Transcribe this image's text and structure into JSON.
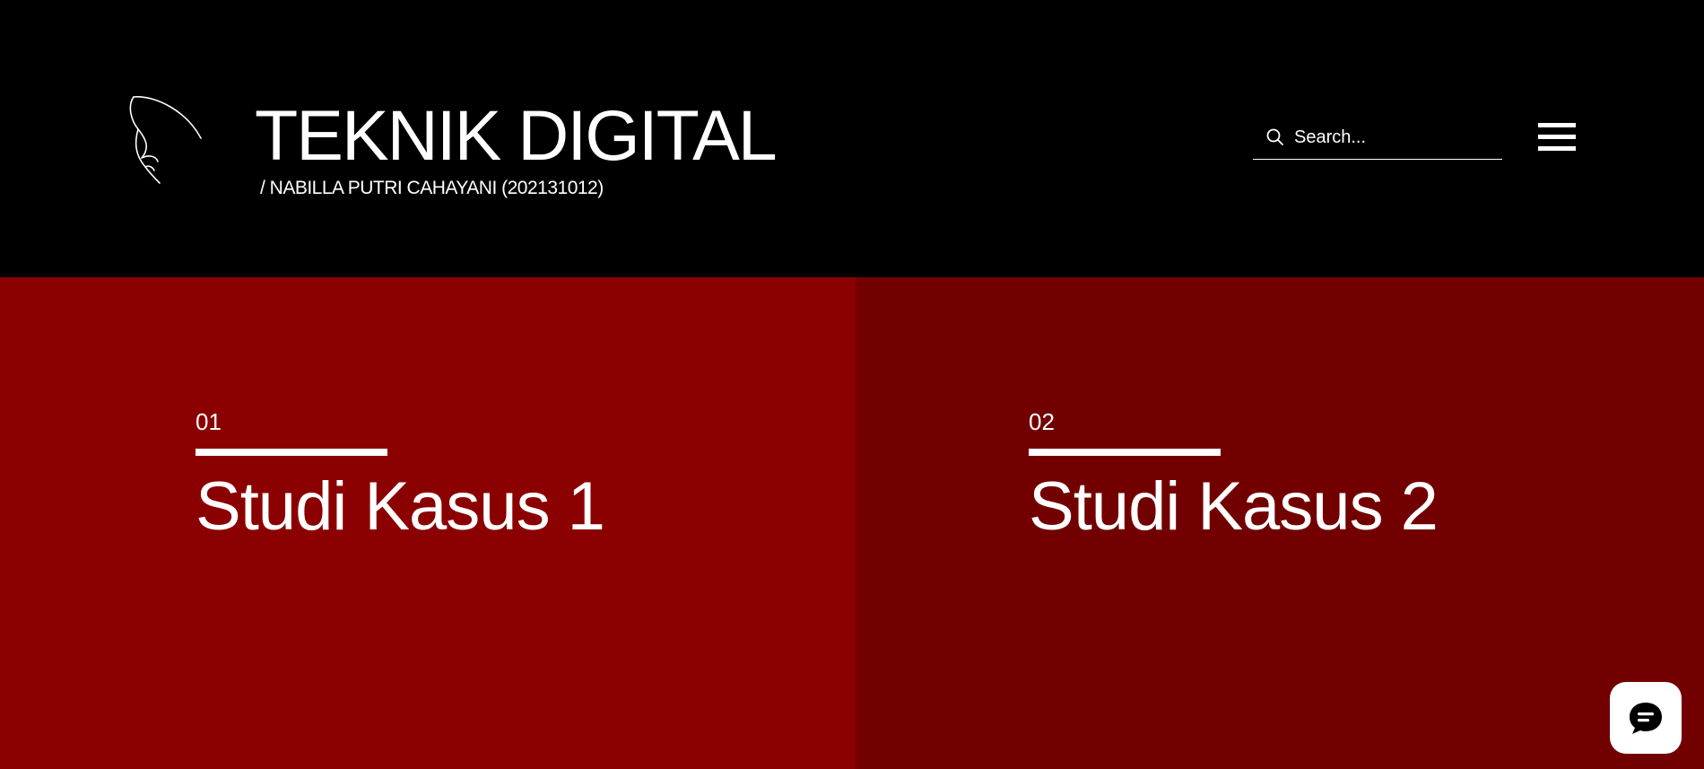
{
  "header": {
    "title": "TEKNIK DIGITAL",
    "subtitle": "/ NABILLA PUTRI CAHAYANI (202131012)",
    "logo_icon": "feather-outline-icon",
    "background": "#000000"
  },
  "search": {
    "placeholder": "Search...",
    "value": "",
    "icon": "search-icon"
  },
  "menu": {
    "icon": "hamburger-menu-icon"
  },
  "panels": [
    {
      "number": "01",
      "title": "Studi Kasus 1",
      "color": "#8b0000"
    },
    {
      "number": "02",
      "title": "Studi Kasus 2",
      "color": "#720000"
    }
  ],
  "chat": {
    "icon": "chat-bubble-icon"
  }
}
